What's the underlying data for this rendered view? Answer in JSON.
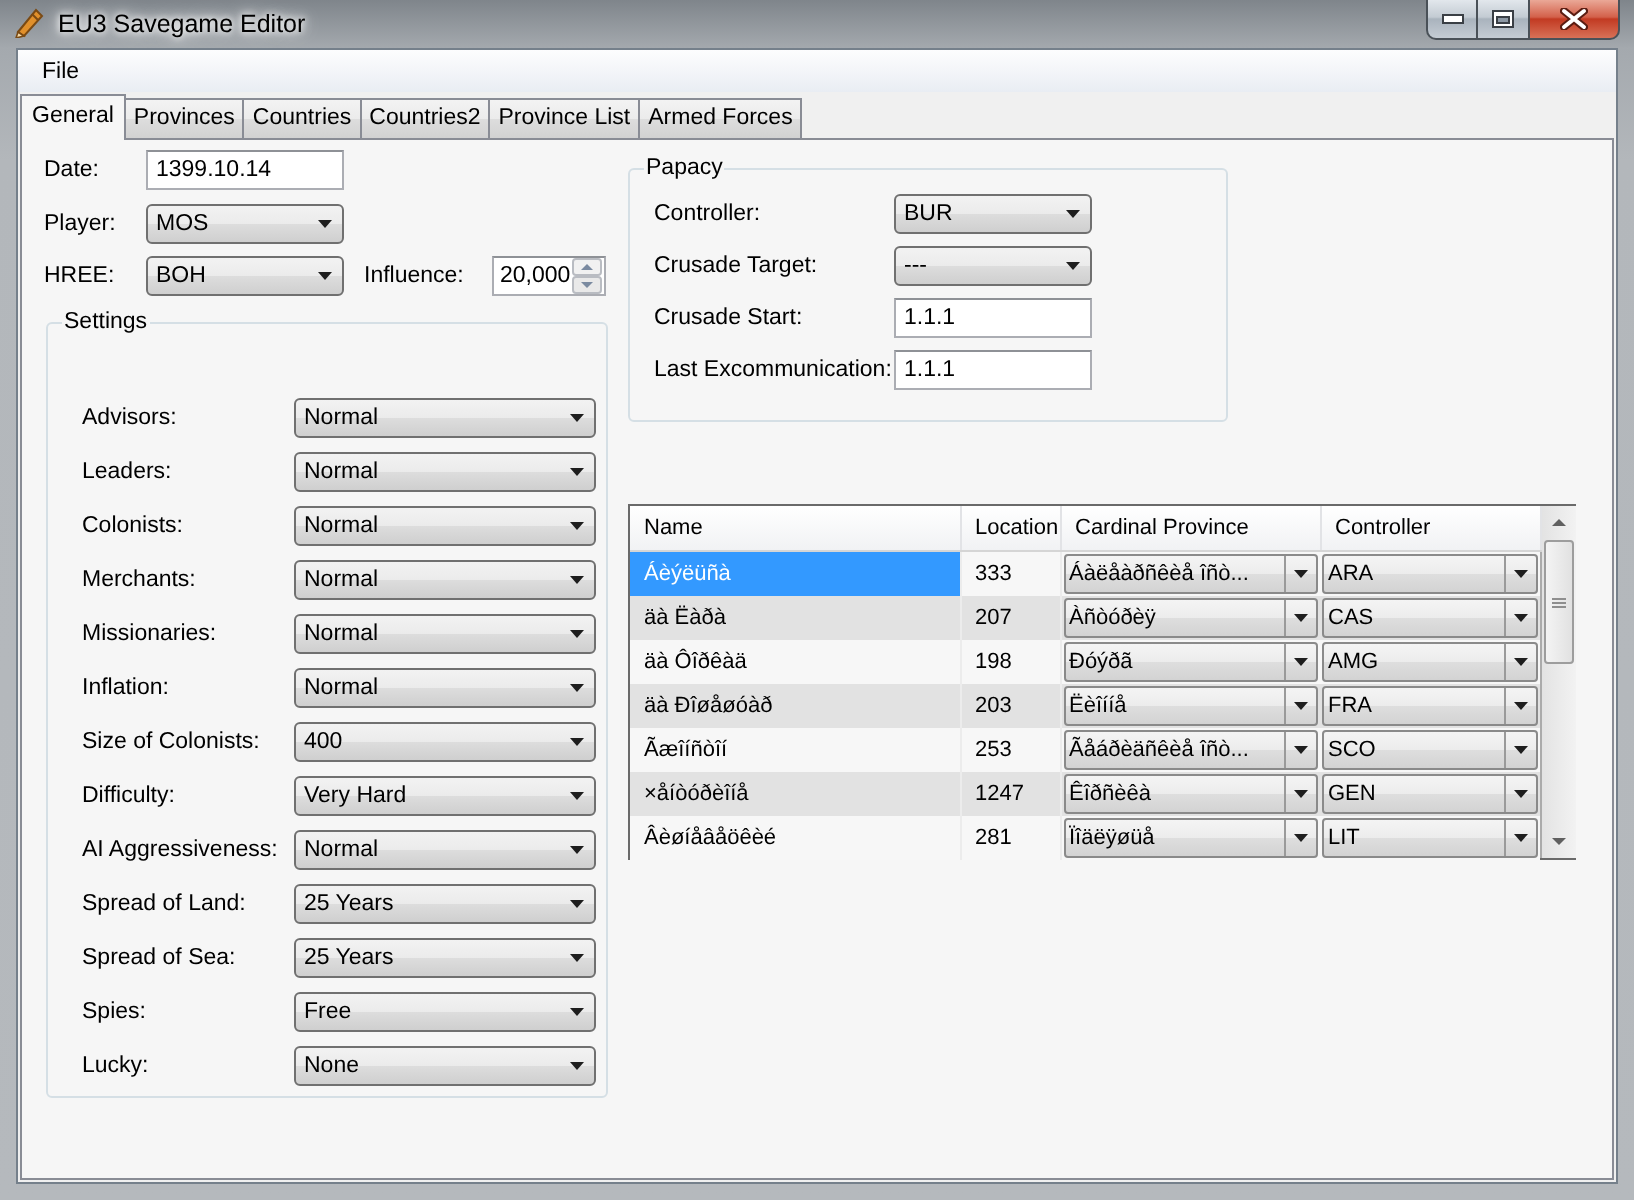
{
  "window": {
    "title": "EU3 Savegame Editor"
  },
  "menu": [
    {
      "label": "File"
    }
  ],
  "tabs": [
    {
      "label": "General",
      "selected": true
    },
    {
      "label": "Provinces",
      "selected": false
    },
    {
      "label": "Countries",
      "selected": false
    },
    {
      "label": "Countries2",
      "selected": false
    },
    {
      "label": "Province List",
      "selected": false
    },
    {
      "label": "Armed Forces",
      "selected": false
    }
  ],
  "general": {
    "rows": [
      {
        "fields": [
          {
            "kind": "text",
            "label": "Date:",
            "value": "1399.10.14"
          }
        ]
      },
      {
        "fields": [
          {
            "kind": "combo",
            "label": "Player:",
            "value": "MOS"
          }
        ]
      },
      {
        "fields": [
          {
            "kind": "combo",
            "label": "HREE:",
            "value": "BOH"
          },
          {
            "kind": "spin",
            "label": "Influence:",
            "value": "20,000"
          }
        ]
      }
    ]
  },
  "settings": {
    "title": "Settings",
    "rows": [
      {
        "label": "Advisors:",
        "value": "Normal"
      },
      {
        "label": "Leaders:",
        "value": "Normal"
      },
      {
        "label": "Colonists:",
        "value": "Normal"
      },
      {
        "label": "Merchants:",
        "value": "Normal"
      },
      {
        "label": "Missionaries:",
        "value": "Normal"
      },
      {
        "label": "Inflation:",
        "value": "Normal"
      },
      {
        "label": "Size of Colonists:",
        "value": "400"
      },
      {
        "label": "Difficulty:",
        "value": "Very Hard"
      },
      {
        "label": "AI Aggressiveness:",
        "value": "Normal"
      },
      {
        "label": "Spread of Land:",
        "value": "25 Years"
      },
      {
        "label": "Spread of Sea:",
        "value": "25 Years"
      },
      {
        "label": "Spies:",
        "value": "Free"
      },
      {
        "label": "Lucky:",
        "value": "None"
      }
    ]
  },
  "papacy": {
    "title": "Papacy",
    "fields": [
      {
        "kind": "combo",
        "label": "Controller:",
        "value": "BUR"
      },
      {
        "kind": "combo",
        "label": "Crusade Target:",
        "value": "---"
      },
      {
        "kind": "text",
        "label": "Crusade Start:",
        "value": "1.1.1"
      },
      {
        "kind": "text",
        "label": "Last Excommunication:",
        "value": "1.1.1"
      }
    ]
  },
  "cardinals": {
    "columns": [
      {
        "label": "Name",
        "kind": "text"
      },
      {
        "label": "Location",
        "kind": "text"
      },
      {
        "label": "Cardinal Province",
        "kind": "combo"
      },
      {
        "label": "Controller",
        "kind": "combo"
      }
    ],
    "rows": [
      {
        "selected": true,
        "cells": [
          "Áèýëüñà",
          "333",
          "Áàëåàðñêèå îñò...",
          "ARA"
        ]
      },
      {
        "selected": false,
        "cells": [
          "äà Ëàðà",
          "207",
          "Àñòóðèÿ",
          "CAS"
        ]
      },
      {
        "selected": false,
        "cells": [
          "äà Ôîðêàä",
          "198",
          "Ðóýðã",
          "AMG"
        ]
      },
      {
        "selected": false,
        "cells": [
          "äà Ðîøåøóàð",
          "203",
          "Ëèîííå",
          "FRA"
        ]
      },
      {
        "selected": false,
        "cells": [
          "Ãæîíñòîí",
          "253",
          "Ãåáðèäñêèå îñò...",
          "SCO"
        ]
      },
      {
        "selected": false,
        "cells": [
          "×åíòóðèîíå",
          "1247",
          "Êîðñèêà",
          "GEN"
        ]
      },
      {
        "selected": false,
        "cells": [
          "Âèøíåâåöêèé",
          "281",
          "Ïîäëÿøüå",
          "LIT"
        ]
      }
    ]
  }
}
